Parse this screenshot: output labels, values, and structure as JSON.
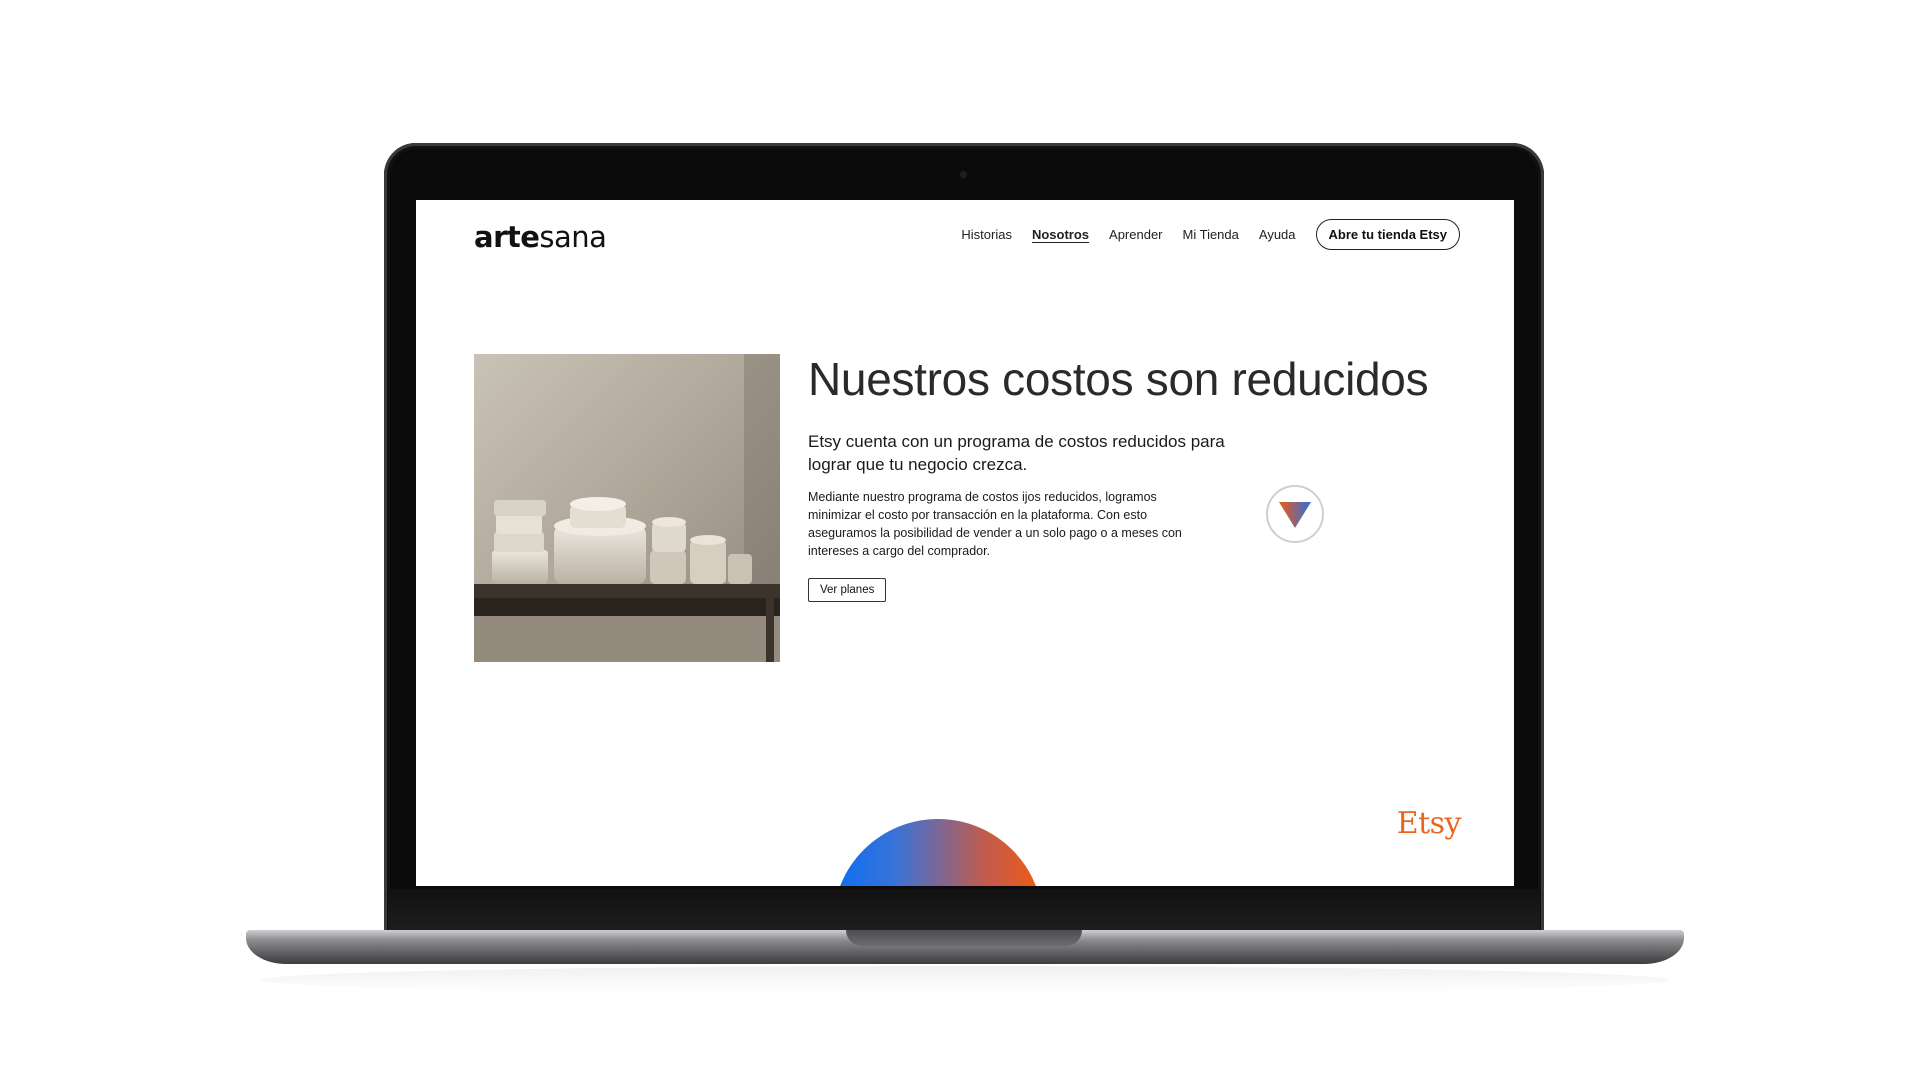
{
  "brand": {
    "part1": "arte",
    "part2": "sana"
  },
  "nav": {
    "items": [
      {
        "label": "Historias"
      },
      {
        "label": "Nosotros",
        "active": true
      },
      {
        "label": "Aprender"
      },
      {
        "label": "Mi Tienda"
      },
      {
        "label": "Ayuda"
      }
    ],
    "cta_label": "Abre tu tienda Etsy"
  },
  "hero": {
    "headline": "Nuestros costos son reducidos",
    "subhead": "Etsy cuenta con un programa de costos reducidos para lograr que tu negocio crezca.",
    "body": "Mediante nuestro programa de costos ijos reducidos, logramos minimizar el costo por transacción en la plataforma. Con esto aseguramos la posibilidad de vender a un solo pago o a meses con intereses a cargo del comprador.",
    "button_label": "Ver planes"
  },
  "footer": {
    "logo": "Etsy"
  },
  "colors": {
    "accent_orange": "#f05a14",
    "accent_blue": "#0a6ef2",
    "etsy_orange": "#e8661c"
  },
  "icons": {
    "scroll": "down-triangle-icon"
  }
}
